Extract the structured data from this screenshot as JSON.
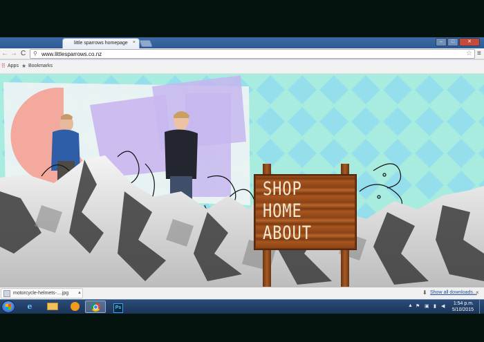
{
  "browser": {
    "tab_title": "little sparrows homepage",
    "tab_close": "×",
    "url": "www.littlesparrows.co.nz",
    "nav": {
      "back": "←",
      "forward": "→",
      "reload": "C"
    },
    "menu": "≡",
    "star": "☆",
    "window_controls": {
      "minimize": "‒",
      "maximize": "□",
      "close": "✕"
    }
  },
  "bookmarks": {
    "apps_label": "Apps",
    "bookmarks_label": "Bookmarks"
  },
  "site": {
    "nav": [
      "SHOP",
      "HOME",
      "ABOUT"
    ]
  },
  "downloads": {
    "file_name": "motorcycle-helmets-....jpg",
    "show_all": "Show all downloads...",
    "close": "×"
  },
  "taskbar": {
    "ie_label": "e",
    "ps_label": "Ps",
    "time": "1:54 p.m.",
    "date": "5/10/2015"
  },
  "colors": {
    "tab_strip": "#2e5a96",
    "sign_wood": "#a9551e",
    "sign_text": "#f4e8d0",
    "page_mint": "#9fe6d8",
    "page_pink": "#f4a99e",
    "page_lilac": "#c9b6ee"
  }
}
